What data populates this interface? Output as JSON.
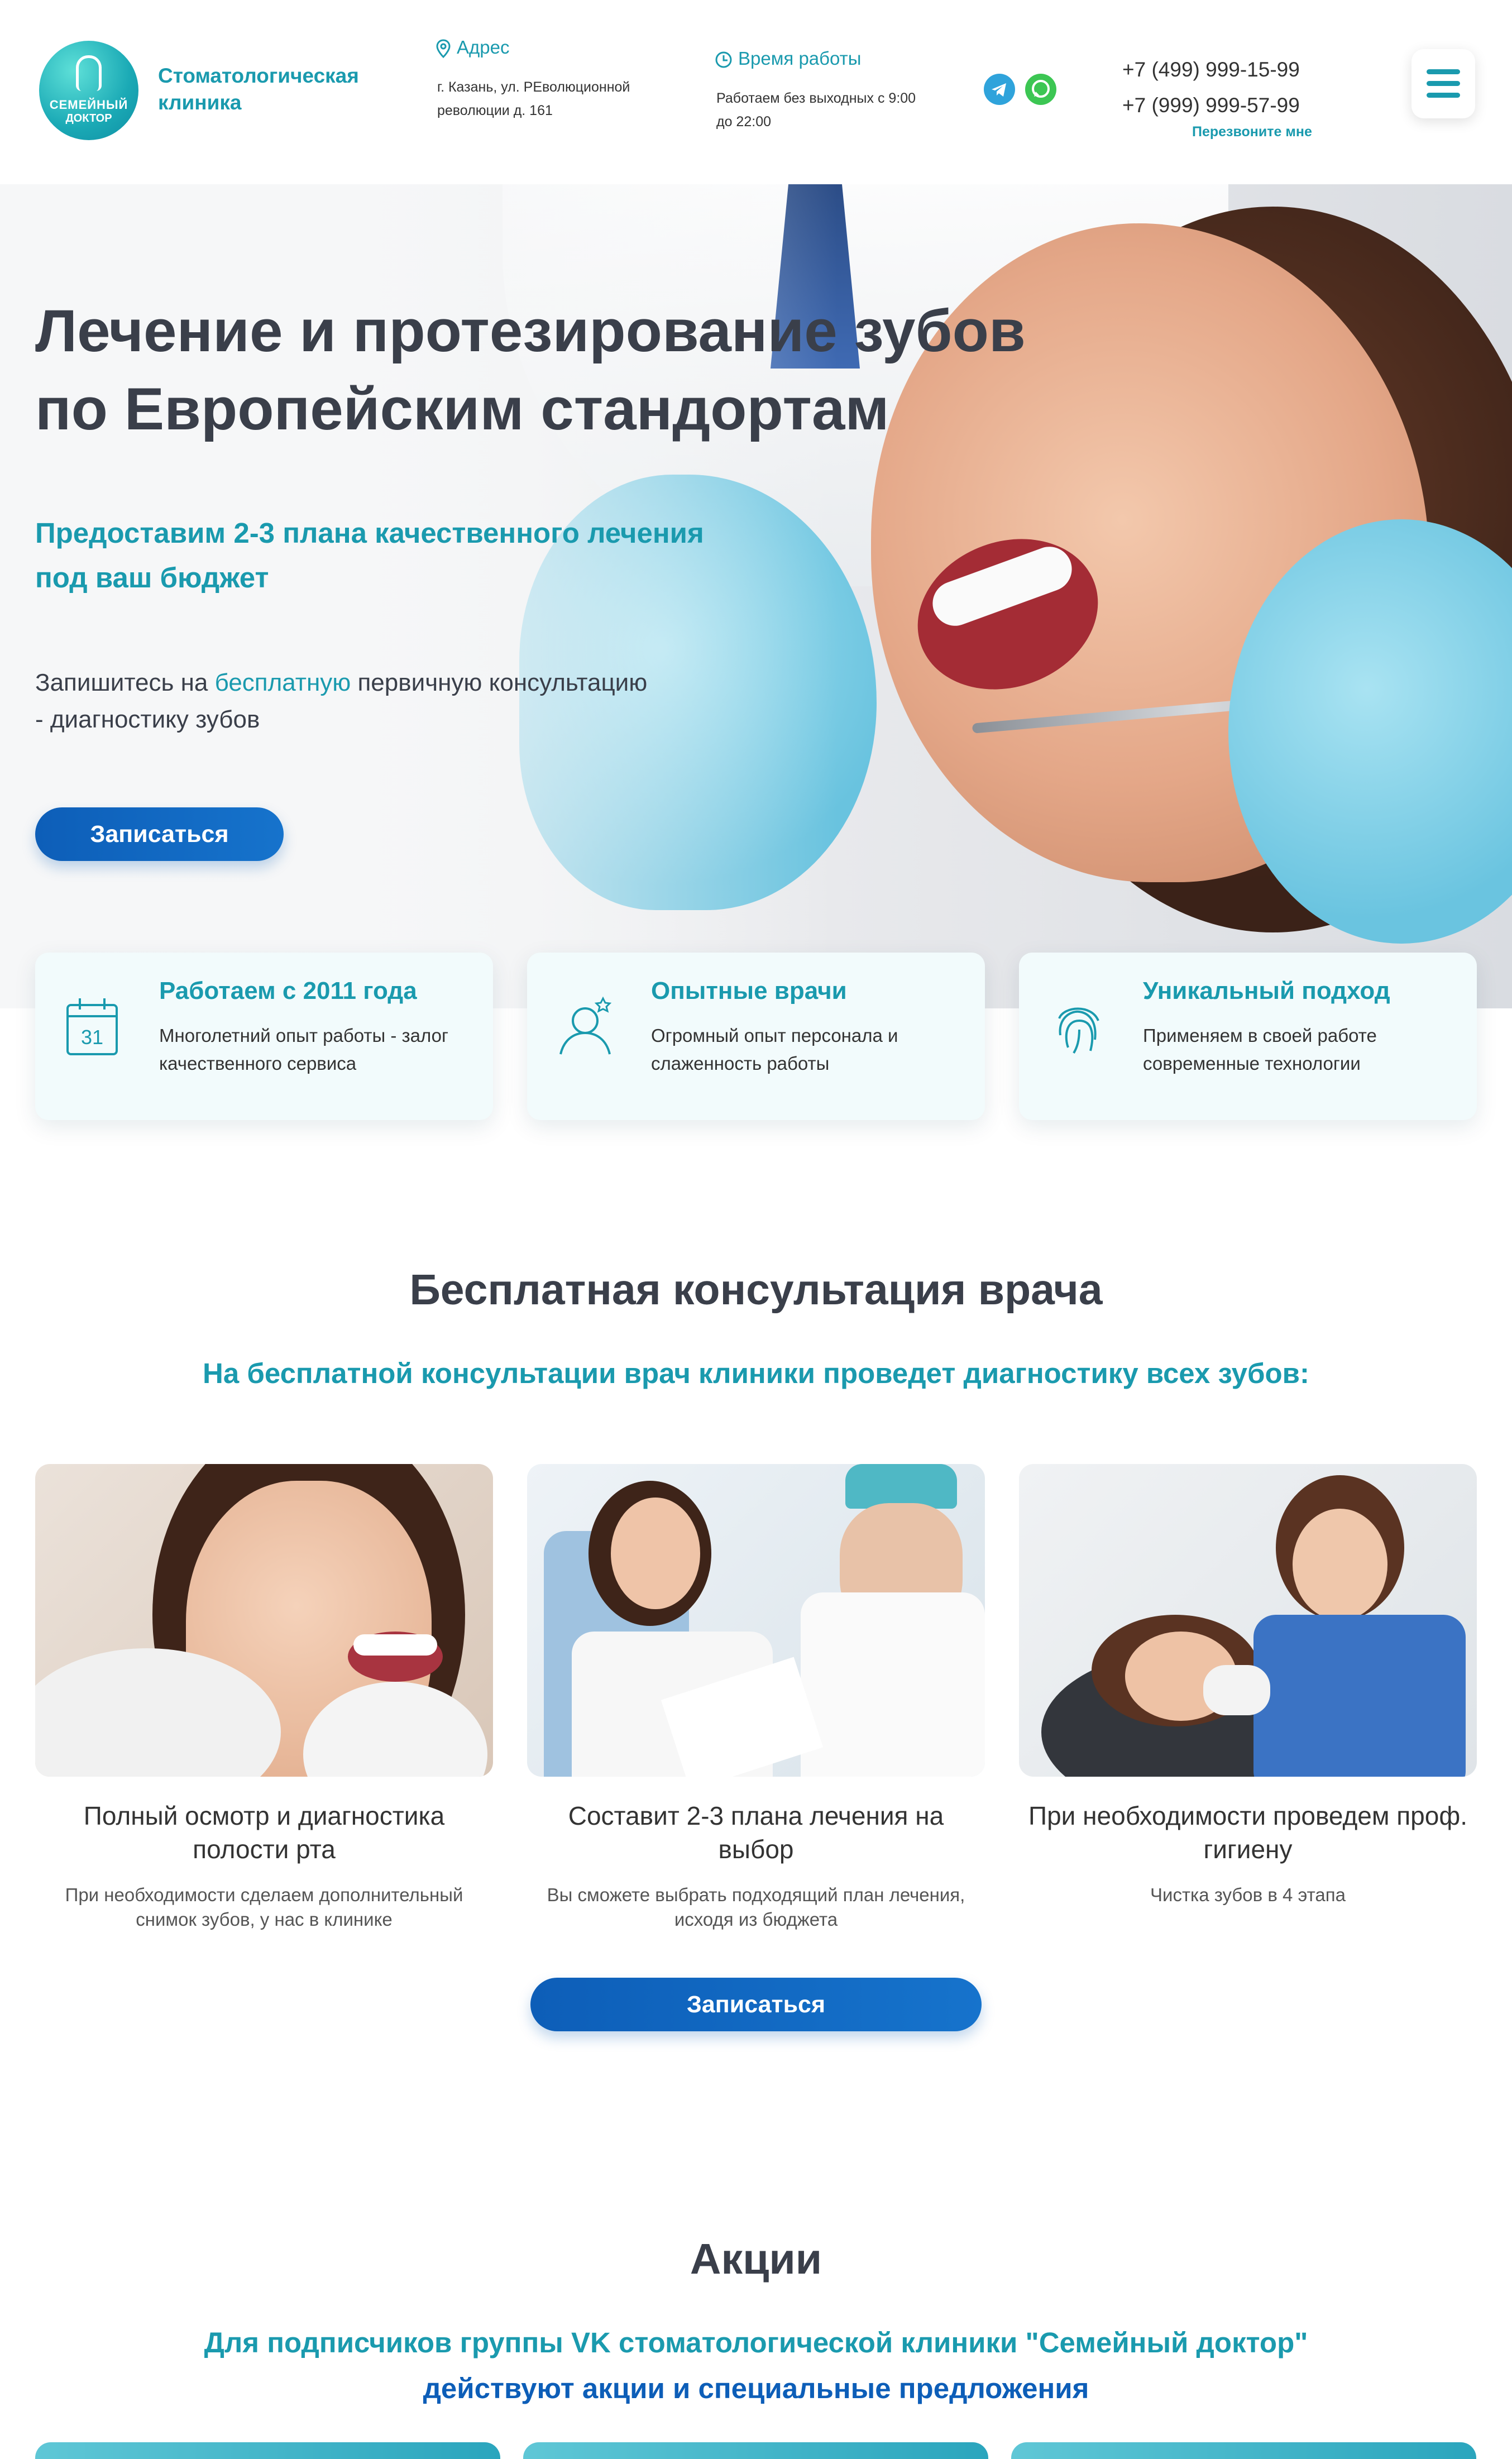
{
  "header": {
    "logo": {
      "line1": "СЕМЕЙНЫЙ",
      "line2": "ДОКТОР"
    },
    "clinic_name": "Стоматологическая клиника",
    "address_label": "Адрес",
    "address_text": "г. Казань, ул. РЕволюционной революции д. 161",
    "hours_label": "Время работы",
    "hours_text": "Работаем без выходных с 9:00 до 22:00",
    "messengers": [
      "telegram-icon",
      "whatsapp-icon"
    ],
    "phone1": "+7 (499) 999-15-99",
    "phone2": "+7 (999) 999-57-99",
    "callback": "Перезвоните мне"
  },
  "hero": {
    "title": "Лечение и протезирование зубов по Европейским стандортам",
    "subtitle": "Предоставим 2-3 плана качественного лечения под ваш бюджет",
    "text_before": "Запишитесь на ",
    "text_highlight": "бесплатную",
    "text_after": " первичную консультацию - диагностику зубов",
    "button": "Записаться"
  },
  "features": [
    {
      "title": "Работаем с 2011 года",
      "text": "Многолетний опыт работы - залог качественного сервиса",
      "icon": "calendar-icon",
      "day": "31"
    },
    {
      "title": "Опытные врачи",
      "text": "Огромный опыт персонала и слаженность работы",
      "icon": "doctor-icon"
    },
    {
      "title": "Уникальный подход",
      "text": "Применяем в своей работе современные технологии",
      "icon": "fingerprint-icon"
    }
  ],
  "consult": {
    "title": "Бесплатная консультация врача",
    "subtitle": "На бесплатной консультации врач клиники проведет диагностику всех зубов:",
    "cards": [
      {
        "title": "Полный осмотр и диагностика полости рта",
        "text": "При необходимости сделаем дополнительный снимок зубов, у нас в клинике"
      },
      {
        "title": "Составит 2-3 плана лечения на выбор",
        "text": "Вы сможете выбрать подходящий план лечения, исходя из бюджета"
      },
      {
        "title": "При необходимости проведем проф. гигиену",
        "text": "Чистка зубов в 4 этапа"
      }
    ],
    "button": "Записаться"
  },
  "promo": {
    "title": "Акции",
    "subtitle1": "Для подписчиков группы VK стоматологической клиники \"Семейный доктор\"",
    "subtitle2": "действуют акции и специальные предложения"
  },
  "colors": {
    "accent": "#1a9aae",
    "button": "#0d5eb8",
    "text": "#3a3f4a"
  }
}
